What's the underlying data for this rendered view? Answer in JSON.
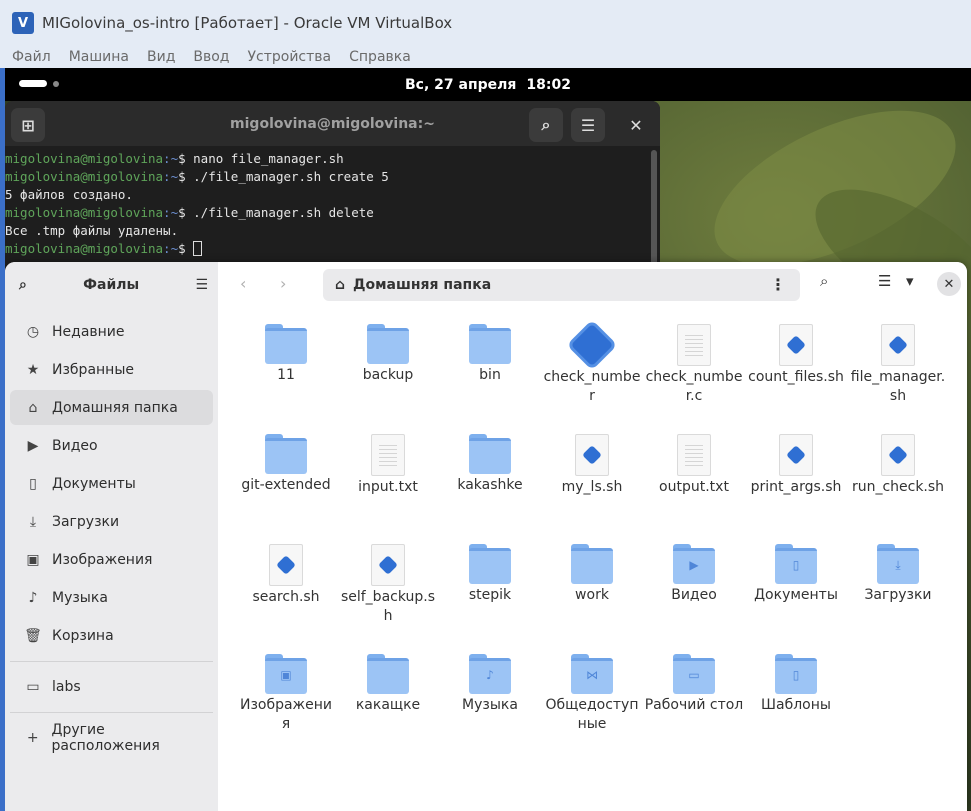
{
  "host": {
    "title": "MIGolovina_os-intro [Работает] - Oracle VM VirtualBox",
    "logo_icon": "virtualbox-logo",
    "menu": [
      "Файл",
      "Машина",
      "Вид",
      "Ввод",
      "Устройства",
      "Справка"
    ]
  },
  "gnome": {
    "day": "Вс, 27 апреля",
    "time": "18:02"
  },
  "terminal": {
    "title": "migolovina@migolovina:~",
    "lines": [
      {
        "user": "migolovina@migolovina",
        "path": ":~",
        "cmd": "$ nano file_manager.sh"
      },
      {
        "user": "migolovina@migolovina",
        "path": ":~",
        "cmd": "$ ./file_manager.sh create 5"
      },
      {
        "output": "5 файлов создано."
      },
      {
        "user": "migolovina@migolovina",
        "path": ":~",
        "cmd": "$ ./file_manager.sh delete"
      },
      {
        "output": "Все .tmp файлы удалены."
      },
      {
        "user": "migolovina@migolovina",
        "path": ":~",
        "cmd": "$ "
      }
    ]
  },
  "files": {
    "sidebar_title": "Файлы",
    "sidebar": [
      {
        "label": "Недавние",
        "icon": "clock-icon",
        "active": false
      },
      {
        "label": "Избранные",
        "icon": "star-icon",
        "active": false
      },
      {
        "label": "Домашняя папка",
        "icon": "home-icon",
        "active": true
      },
      {
        "label": "Видео",
        "icon": "video-icon",
        "active": false
      },
      {
        "label": "Документы",
        "icon": "document-icon",
        "active": false
      },
      {
        "label": "Загрузки",
        "icon": "download-icon",
        "active": false
      },
      {
        "label": "Изображения",
        "icon": "image-icon",
        "active": false
      },
      {
        "label": "Музыка",
        "icon": "music-icon",
        "active": false
      },
      {
        "label": "Корзина",
        "icon": "trash-icon",
        "active": false
      }
    ],
    "bookmarks": [
      {
        "label": "labs",
        "icon": "folder-icon"
      }
    ],
    "other_locations": {
      "label": "Другие расположения",
      "icon": "plus-icon"
    },
    "location": "Домашняя папка",
    "items": [
      {
        "name": "11",
        "type": "folder"
      },
      {
        "name": "backup",
        "type": "folder"
      },
      {
        "name": "bin",
        "type": "folder"
      },
      {
        "name": "check_number",
        "type": "exec"
      },
      {
        "name": "check_number.c",
        "type": "text"
      },
      {
        "name": "count_files.sh",
        "type": "script"
      },
      {
        "name": "file_manager.sh",
        "type": "script"
      },
      {
        "name": "git-extended",
        "type": "folder"
      },
      {
        "name": "input.txt",
        "type": "text"
      },
      {
        "name": "kakashke",
        "type": "folder"
      },
      {
        "name": "my_ls.sh",
        "type": "script"
      },
      {
        "name": "output.txt",
        "type": "text"
      },
      {
        "name": "print_args.sh",
        "type": "script"
      },
      {
        "name": "run_check.sh",
        "type": "script"
      },
      {
        "name": "search.sh",
        "type": "script"
      },
      {
        "name": "self_backup.sh",
        "type": "script"
      },
      {
        "name": "stepik",
        "type": "folder"
      },
      {
        "name": "work",
        "type": "folder"
      },
      {
        "name": "Видео",
        "type": "folder",
        "emblem": "video-icon"
      },
      {
        "name": "Документы",
        "type": "folder",
        "emblem": "document-icon"
      },
      {
        "name": "Загрузки",
        "type": "folder",
        "emblem": "download-icon"
      },
      {
        "name": "Изображения",
        "type": "folder",
        "emblem": "image-icon"
      },
      {
        "name": "какащке",
        "type": "folder"
      },
      {
        "name": "Музыка",
        "type": "folder",
        "emblem": "music-icon"
      },
      {
        "name": "Общедоступные",
        "type": "folder",
        "emblem": "share-icon"
      },
      {
        "name": "Рабочий стол",
        "type": "folder",
        "emblem": "desktop-icon"
      },
      {
        "name": "Шаблоны",
        "type": "folder",
        "emblem": "template-icon"
      }
    ]
  }
}
